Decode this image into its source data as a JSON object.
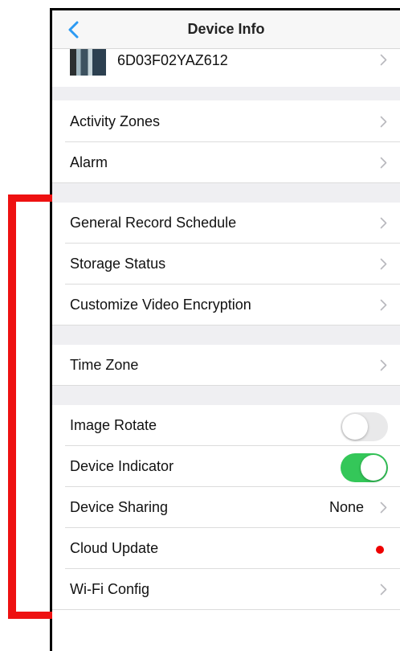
{
  "nav": {
    "title": "Device Info"
  },
  "device": {
    "id": "6D03F02YAZ612"
  },
  "rows": {
    "activity_zones": "Activity Zones",
    "alarm": "Alarm",
    "general_record_schedule": "General Record Schedule",
    "storage_status": "Storage Status",
    "customize_video_encryption": "Customize Video Encryption",
    "time_zone": "Time Zone",
    "image_rotate": "Image Rotate",
    "device_indicator": "Device Indicator",
    "device_sharing": "Device Sharing",
    "device_sharing_value": "None",
    "cloud_update": "Cloud Update",
    "wifi_config": "Wi-Fi Config"
  },
  "toggles": {
    "image_rotate": false,
    "device_indicator": true
  },
  "colors": {
    "accent": "#2b9af3",
    "toggle_on": "#34c759",
    "toggle_off": "#e9e9ea",
    "badge_red": "#ee0000",
    "annotation_red": "#ee1111",
    "group_background": "#efeff2"
  },
  "icons": {
    "back": "chevron-left-icon",
    "disclosure": "chevron-right-icon"
  }
}
